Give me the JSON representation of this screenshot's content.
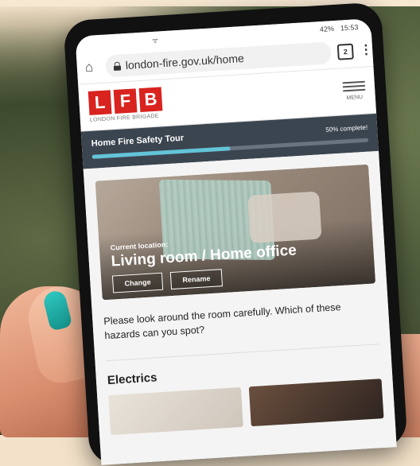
{
  "status_bar": {
    "time": "15:53",
    "battery": "42%",
    "signal": "ᯤ"
  },
  "browser": {
    "url": "london-fire.gov.uk/home",
    "tab_count": "2"
  },
  "header": {
    "logo_letters": [
      "L",
      "F",
      "B"
    ],
    "logo_subtitle": "LONDON FIRE BRIGADE",
    "menu_label": "MENU"
  },
  "tour": {
    "title": "Home Fire Safety Tour",
    "complete_label": "50% complete!",
    "progress_fraction": 0.5
  },
  "room": {
    "kicker": "Current location:",
    "title": "Living room / Home office",
    "change_label": "Change",
    "rename_label": "Rename"
  },
  "prompt_text": "Please look around the room carefully. Which of these hazards can you spot?",
  "section": {
    "title": "Electrics"
  },
  "colors": {
    "brand_red": "#d8231f",
    "tour_bg": "#3b4550",
    "progress": "#63c4d8",
    "nail": "#1fb3ac"
  }
}
